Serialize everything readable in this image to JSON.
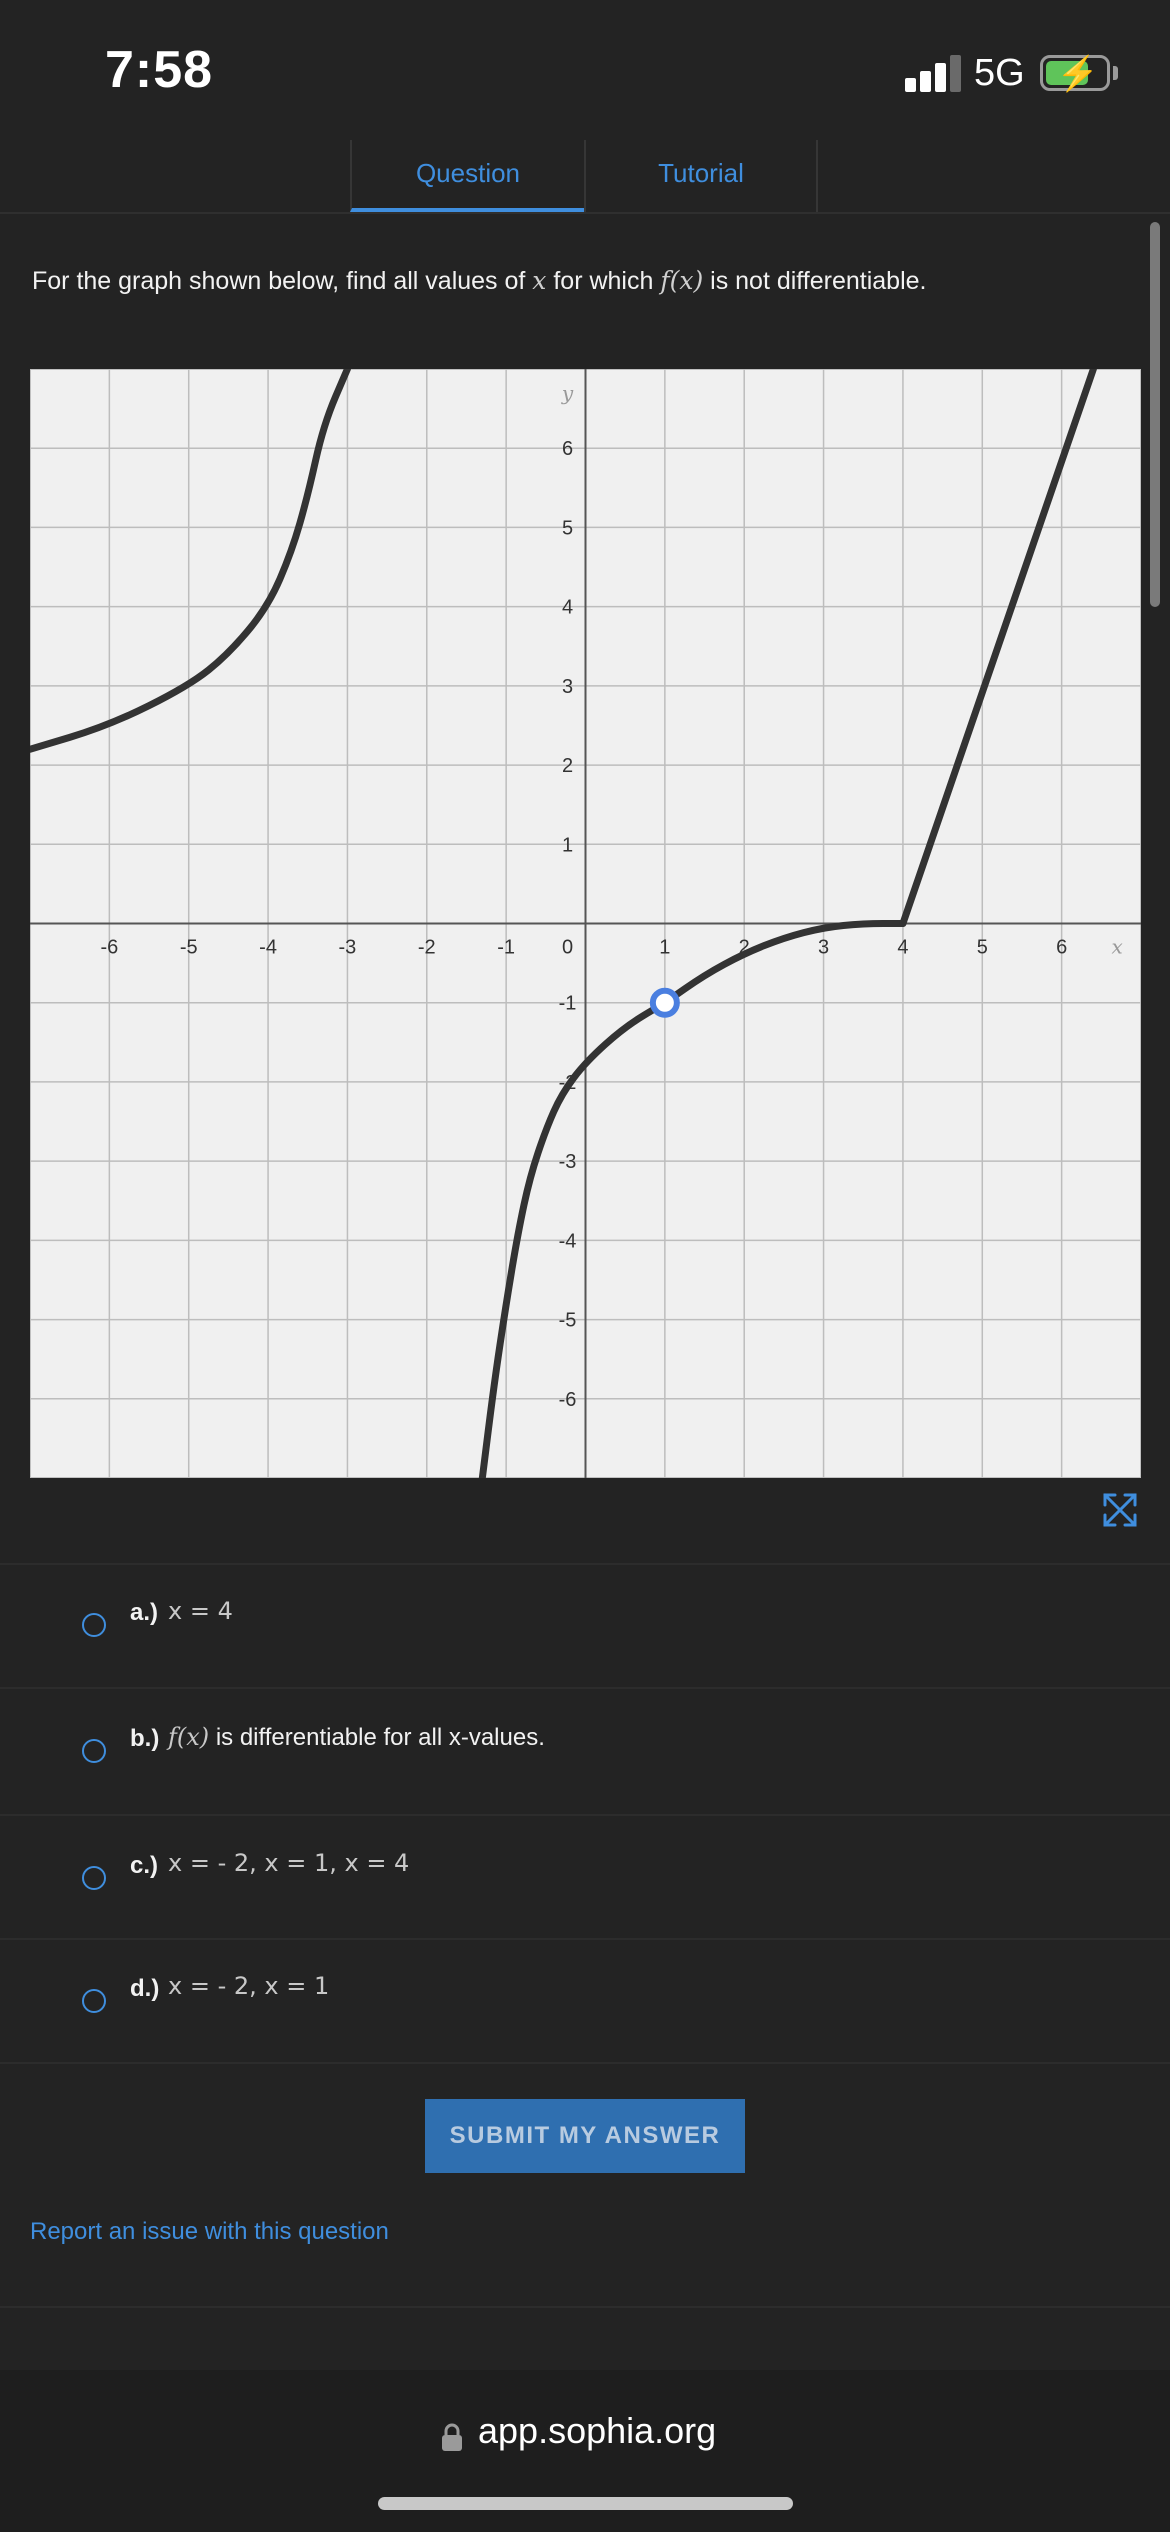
{
  "status_bar": {
    "time": "7:58",
    "network": "5G",
    "battery_icon": "battery-charging-icon",
    "signal_icon": "cellular-signal-icon"
  },
  "tabs": [
    {
      "label": "Question",
      "active": true
    },
    {
      "label": "Tutorial",
      "active": false
    }
  ],
  "question": {
    "prompt_before": "For the graph shown below, find all values of ",
    "prompt_var": "x",
    "prompt_middle": " for which ",
    "prompt_fn": "f(x)",
    "prompt_after": " is not differentiable."
  },
  "graph": {
    "x_axis_label": "x",
    "y_axis_label": "y",
    "x_ticks": [
      "-6",
      "-5",
      "-4",
      "-3",
      "-2",
      "-1",
      "0",
      "1",
      "2",
      "3",
      "4",
      "5",
      "6"
    ],
    "y_ticks": [
      "6",
      "5",
      "4",
      "3",
      "2",
      "1",
      "-1",
      "-2",
      "-3",
      "-4",
      "-5",
      "-6"
    ],
    "x_range": [
      -7,
      7
    ],
    "y_range": [
      -7,
      7
    ],
    "curve_color": "#333333",
    "open_point_color": "#4a7fe0",
    "open_point": {
      "x": 1,
      "y": -1
    },
    "left_branch": [
      [
        -7,
        2.2
      ],
      [
        -6,
        2.5
      ],
      [
        -5,
        3.0
      ],
      [
        -4.5,
        3.4
      ],
      [
        -4,
        4.0
      ],
      [
        -3.7,
        4.7
      ],
      [
        -3.5,
        5.4
      ],
      [
        -3.3,
        6.3
      ],
      [
        -3.0,
        7.0
      ]
    ],
    "lower_left": [
      [
        -1.3,
        -7
      ],
      [
        -1.15,
        -5.8
      ],
      [
        -1,
        -4.8
      ],
      [
        -0.85,
        -3.9
      ],
      [
        -0.7,
        -3.2
      ],
      [
        -0.5,
        -2.6
      ],
      [
        -0.3,
        -2.15
      ],
      [
        0,
        -1.75
      ],
      [
        0.5,
        -1.3
      ],
      [
        1,
        -1.0
      ]
    ],
    "middle": [
      [
        1,
        -1.0
      ],
      [
        1.5,
        -0.65
      ],
      [
        2,
        -0.38
      ],
      [
        2.5,
        -0.18
      ],
      [
        3,
        -0.05
      ],
      [
        3.5,
        0
      ],
      [
        4,
        0
      ]
    ],
    "right_line": [
      [
        4,
        0
      ],
      [
        6.4,
        7
      ]
    ]
  },
  "options": [
    {
      "letter": "a.)",
      "math": "x = 4"
    },
    {
      "letter": "b.)",
      "fn": "f(x)",
      "text": " is differentiable for all x-values."
    },
    {
      "letter": "c.)",
      "math": "x = - 2, x = 1, x = 4"
    },
    {
      "letter": "d.)",
      "math": "x = - 2, x = 1"
    }
  ],
  "submit_label": "SUBMIT MY ANSWER",
  "report_link": "Report an issue with this question",
  "browser": {
    "url": "app.sophia.org"
  },
  "colors": {
    "accent": "#3f8ede",
    "background": "#232323",
    "submit": "#2f6fb0",
    "plot_background": "#f0f0f0"
  }
}
